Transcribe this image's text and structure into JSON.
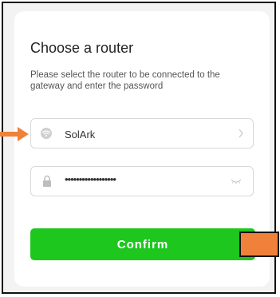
{
  "page": {
    "title": "Choose a router",
    "subtitle": "Please select the router to be connected to the gateway and enter the password"
  },
  "router_field": {
    "value": "SolArk",
    "icon": "wifi-icon",
    "trailing_icon": "chevron-right-icon"
  },
  "password_field": {
    "value": "••••••••••••••••••",
    "icon": "lock-icon",
    "trailing_icon": "eye-closed-icon"
  },
  "confirm_button": {
    "label": "Confirm"
  },
  "annotations": {
    "arrow_icon": "arrow-right-icon",
    "color": "#f0813a"
  },
  "colors": {
    "accent": "#1ec71e",
    "background": "#f3f3f3",
    "card": "#ffffff"
  }
}
